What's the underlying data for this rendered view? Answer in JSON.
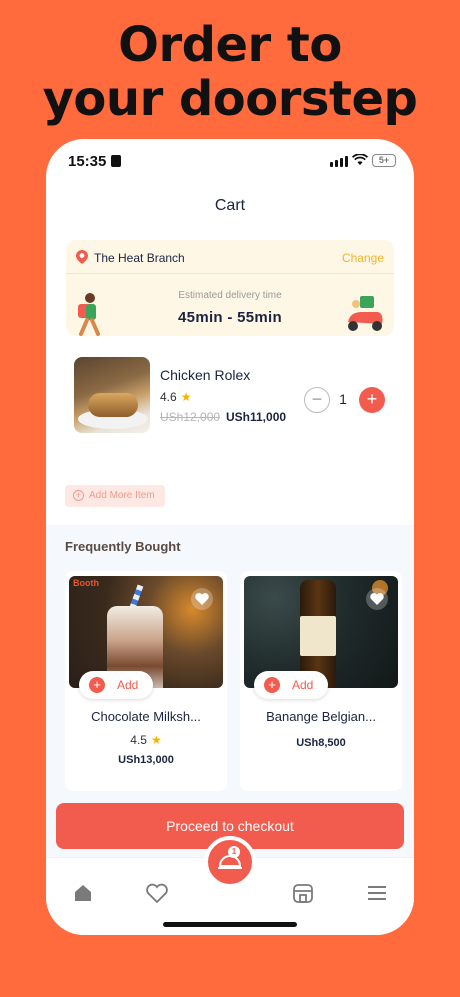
{
  "headline": {
    "line1": "Order to",
    "line2": "your doorstep"
  },
  "status_bar": {
    "time": "15:35",
    "battery": "5+"
  },
  "page": {
    "title": "Cart"
  },
  "delivery": {
    "branch": "The Heat Branch",
    "change_label": "Change",
    "eta_label": "Estimated delivery time",
    "eta_value": "45min - 55min"
  },
  "cart_item": {
    "name": "Chicken Rolex",
    "rating": "4.6",
    "old_price": "USh12,000",
    "new_price": "USh11,000",
    "quantity": "1"
  },
  "add_more_label": "Add More Item",
  "frequently_bought": {
    "title": "Frequently Bought",
    "products": [
      {
        "name": "Chocolate Milksh...",
        "rating": "4.5",
        "price": "USh13,000",
        "add_label": "Add",
        "logo": "Booth"
      },
      {
        "name": "Banange Belgian...",
        "price": "USh8,500",
        "add_label": "Add"
      }
    ]
  },
  "checkout_label": "Proceed to checkout",
  "tabbar": {
    "cart_badge": "1"
  },
  "colors": {
    "brand": "#FF6B3D",
    "accent": "#F25C4E",
    "change": "#F4B42C"
  }
}
